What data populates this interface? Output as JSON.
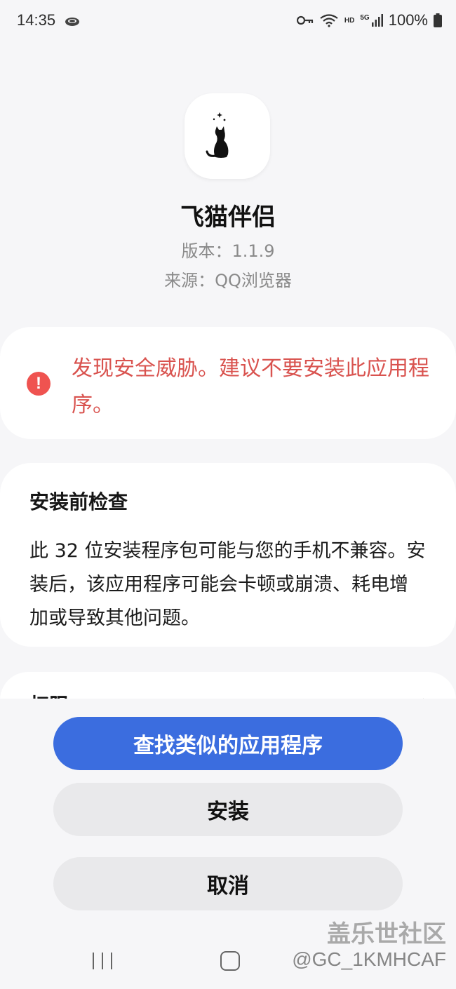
{
  "status_bar": {
    "time": "14:35",
    "network_label": "HD",
    "signal_label": "5G",
    "battery": "100%",
    "icons": [
      "cloud-icon",
      "key-icon",
      "wifi-icon",
      "signal-icon",
      "battery-icon"
    ]
  },
  "app": {
    "icon": "cat-moon-icon",
    "name": "飞猫伴侣",
    "version": "版本：1.1.9",
    "source": "来源：QQ浏览器"
  },
  "warning": {
    "icon": "alert-icon",
    "icon_glyph": "!",
    "text": "发现安全威胁。建议不要安装此应用程序。",
    "color": "#d9534f"
  },
  "pre_install_check": {
    "title": "安装前检查",
    "body": "此 32 位安装程序包可能与您的手机不兼容。安装后，该应用程序可能会卡顿或崩溃、耗电增加或导致其他问题。"
  },
  "permissions": {
    "title": "权限"
  },
  "buttons": {
    "find_similar": "查找类似的应用程序",
    "install": "安装",
    "cancel": "取消",
    "primary_color": "#3b6ddf"
  },
  "watermark": {
    "site": "盖乐世社区",
    "user": "@GC_1KMHCAF"
  },
  "nav_bar": {
    "icons": [
      "recents-icon",
      "home-icon"
    ]
  }
}
